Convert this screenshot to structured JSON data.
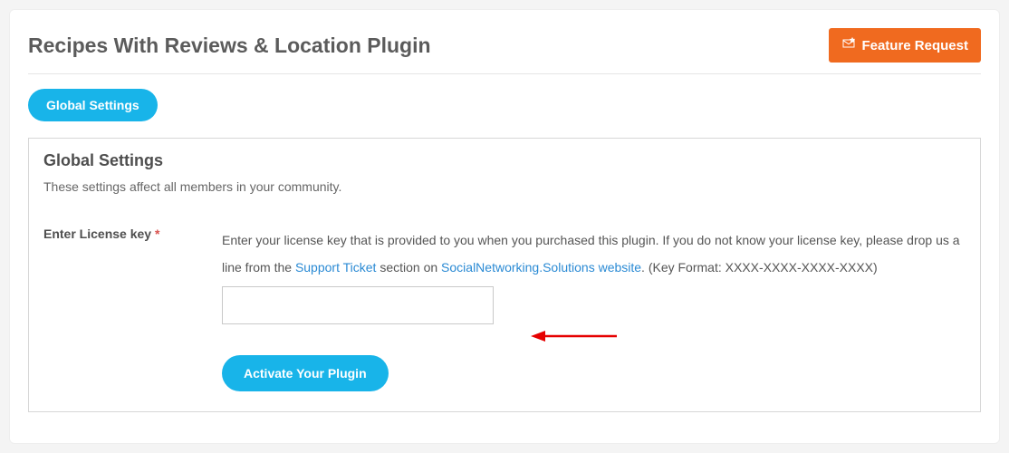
{
  "header": {
    "title": "Recipes With Reviews & Location Plugin",
    "feature_button": "Feature Request"
  },
  "tabs": {
    "global_settings": "Global Settings"
  },
  "section": {
    "title": "Global Settings",
    "description": "These settings affect all members in your community."
  },
  "form": {
    "label": "Enter License key",
    "required_mark": "*",
    "help_part1": "Enter your license key that is provided to you when you purchased this plugin. If you do not know your license key, please drop us a line from the ",
    "link1": "Support Ticket",
    "help_part2": " section on ",
    "link2": "SocialNetworking.Solutions website",
    "help_part3": ". (Key Format: XXXX-XXXX-XXXX-XXXX)",
    "input_value": "",
    "submit": "Activate Your Plugin"
  }
}
